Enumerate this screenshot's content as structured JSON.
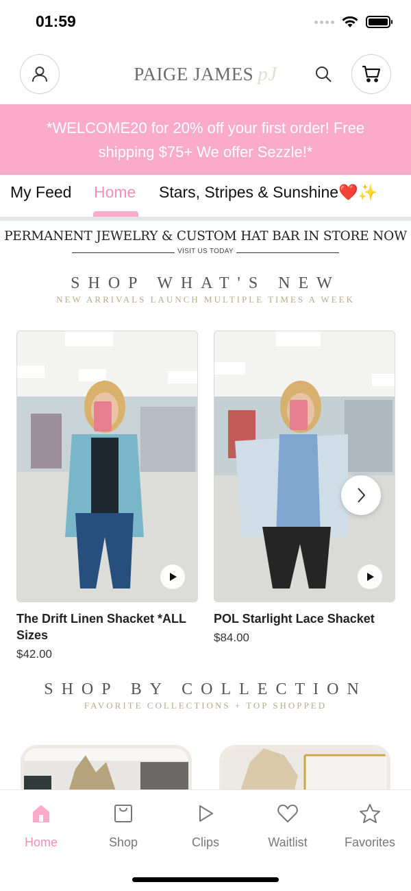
{
  "status_bar": {
    "time": "01:59"
  },
  "header": {
    "brand": "PAIGE JAMES",
    "brand_mark": "pJ"
  },
  "promo": {
    "line1": "*WELCOME20 for 20% off your first order! Free",
    "line2": "shipping $75+ We offer Sezzle!*"
  },
  "tabs": [
    {
      "label": "My Feed",
      "active": false
    },
    {
      "label": "Home",
      "active": true
    },
    {
      "label": "Stars, Stripes & Sunshine❤️✨",
      "active": false
    }
  ],
  "announcement": {
    "title": "PERMANENT JEWELRY & CUSTOM HAT BAR IN STORE NOW",
    "subtitle": "VISIT US TODAY"
  },
  "new_section": {
    "title": "SHOP WHAT'S NEW",
    "subtitle": "NEW ARRIVALS LAUNCH MULTIPLE TIMES A WEEK"
  },
  "products": [
    {
      "name": "The Drift Linen Shacket *ALL Sizes",
      "price": "$42.00"
    },
    {
      "name": "POL Starlight Lace Shacket",
      "price": "$84.00"
    }
  ],
  "collection_section": {
    "title": "SHOP BY COLLECTION",
    "subtitle": "FAVORITE COLLECTIONS + TOP SHOPPED"
  },
  "tabbar": [
    {
      "label": "Home",
      "icon": "home-icon",
      "active": true
    },
    {
      "label": "Shop",
      "icon": "shopping-bag-icon",
      "active": false
    },
    {
      "label": "Clips",
      "icon": "play-icon",
      "active": false
    },
    {
      "label": "Waitlist",
      "icon": "heart-icon",
      "active": false
    },
    {
      "label": "Favorites",
      "icon": "star-icon",
      "active": false
    }
  ],
  "colors": {
    "accent_pink": "#f9abc9",
    "active_pink": "#f48fb6"
  }
}
